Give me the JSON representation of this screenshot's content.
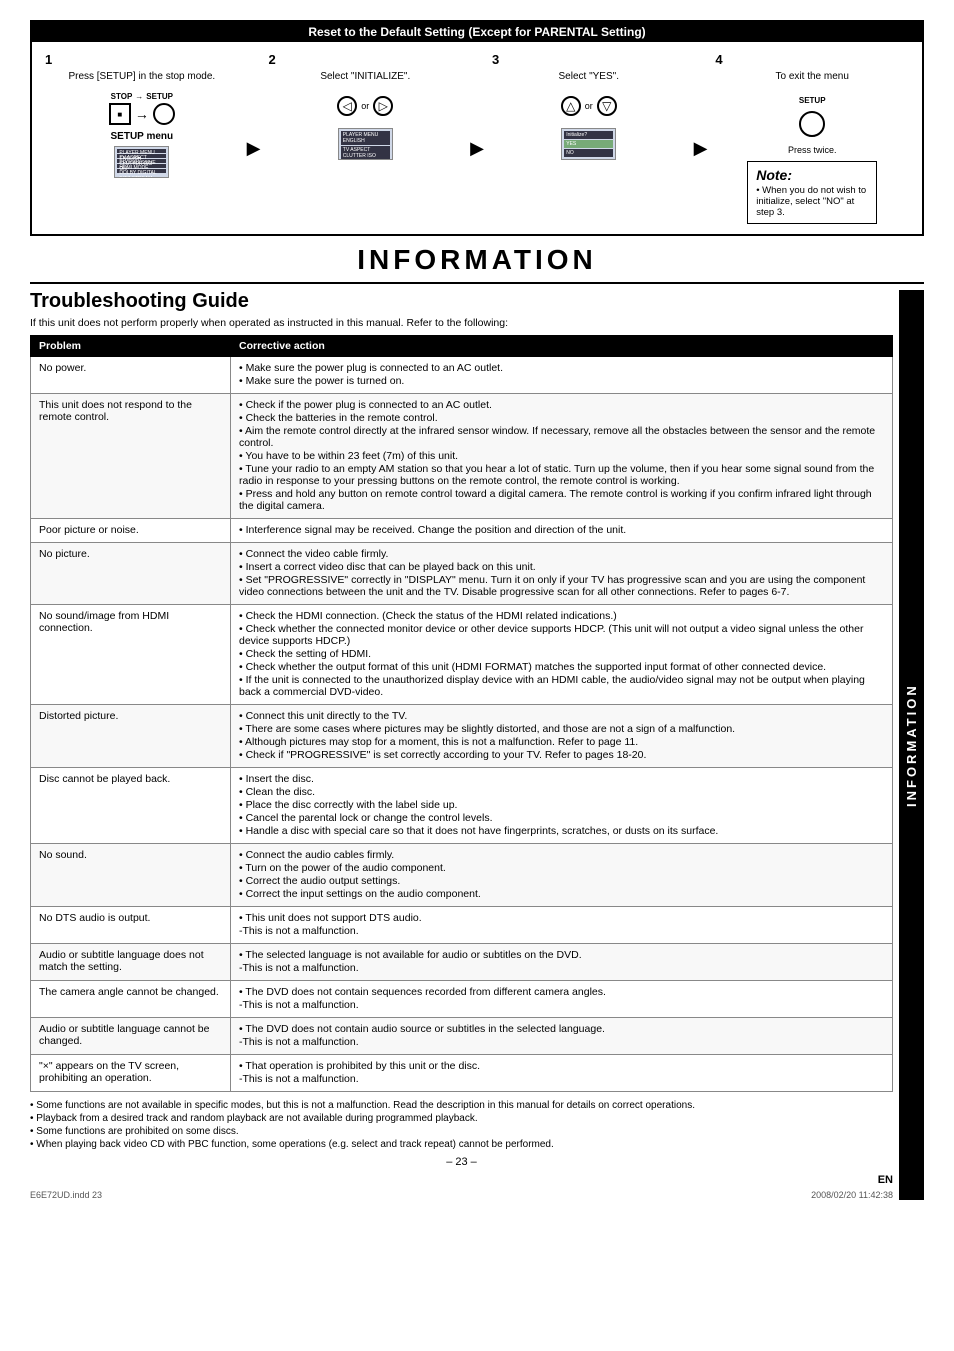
{
  "reset_section": {
    "title": "Reset to the Default Setting (Except for PARENTAL Setting)",
    "steps": [
      {
        "number": "1",
        "desc": "Press [SETUP] in the stop mode.",
        "labels": [
          "STOP",
          "SETUP"
        ],
        "sub": "SETUP menu"
      },
      {
        "number": "2",
        "desc": "Select \"INITIALIZE\"."
      },
      {
        "number": "3",
        "desc": "Select \"YES\"."
      },
      {
        "number": "4",
        "desc": "To exit the menu",
        "press": "Press twice."
      }
    ],
    "note_label": "Note:",
    "note_text": "• When you do not wish to initialize, select \"NO\" at step 3."
  },
  "information_heading": "INFORMATION",
  "troubleshooting_title": "Troubleshooting Guide",
  "intro_text": "If this unit does not perform properly when operated as instructed in this manual. Refer to the following:",
  "table_headers": [
    "Problem",
    "Corrective action"
  ],
  "table_rows": [
    {
      "problem": "No power.",
      "action": "• Make sure the power plug is connected to an AC outlet.\n• Make sure the power is turned on."
    },
    {
      "problem": "This unit does not respond to the remote control.",
      "action": "• Check if the power plug is connected to an AC outlet.\n• Check the batteries in the remote control.\n• Aim the remote control directly at the infrared sensor window. If necessary, remove all the obstacles between the sensor and the remote control.\n• You have to be within 23 feet (7m) of this unit.\n• Tune your radio to an empty AM station so that you hear a lot of static. Turn up the volume, then if you hear some signal sound from the radio in response to your pressing buttons on the remote control, the remote control is working.\n• Press and hold any button on remote control toward a digital camera. The remote control is working if you confirm infrared light through the digital camera."
    },
    {
      "problem": "Poor picture or noise.",
      "action": "• Interference signal may be received. Change the position and direction of the unit."
    },
    {
      "problem": "No picture.",
      "action": "• Connect the video cable firmly.\n• Insert a correct video disc that can be played back on this unit.\n• Set \"PROGRESSIVE\" correctly in \"DISPLAY\" menu. Turn it on only if your TV has progressive scan and you are using the component video connections between the unit and the TV. Disable progressive scan for all other connections. Refer to pages 6-7."
    },
    {
      "problem": "No sound/image from HDMI connection.",
      "action": "• Check the HDMI connection. (Check the status of the HDMI related indications.)\n• Check whether the connected monitor device or other device supports HDCP. (This unit will not output a video signal unless the other device supports HDCP.)\n• Check the setting of HDMI.\n• Check whether the output format of this unit (HDMI FORMAT) matches the supported input format of other connected device.\n• If the unit is connected to the unauthorized display device with an HDMI cable, the audio/video signal may not be output when playing back a commercial DVD-video."
    },
    {
      "problem": "Distorted picture.",
      "action": "• Connect this unit directly to the TV.\n• There are some cases where pictures may be slightly distorted, and those are not a sign of a malfunction.\n• Although pictures may stop for a moment, this is not a malfunction. Refer to page 11.\n• Check if \"PROGRESSIVE\" is set correctly according to your TV. Refer to pages 18-20."
    },
    {
      "problem": "Disc cannot be played back.",
      "action": "• Insert the disc.\n• Clean the disc.\n• Place the disc correctly with the label side up.\n• Cancel the parental lock or change the control levels.\n• Handle a disc with special care so that it does not have fingerprints, scratches, or dusts on its surface."
    },
    {
      "problem": "No sound.",
      "action": "• Connect the audio cables firmly.\n• Turn on the power of the audio component.\n• Correct the audio output settings.\n• Correct the input settings on the audio component."
    },
    {
      "problem": "No DTS audio is output.",
      "action": "• This unit does not support DTS audio.\n-This is not a malfunction."
    },
    {
      "problem": "Audio or subtitle language does not match the setting.",
      "action": "• The selected language is not available for audio or subtitles on the DVD.\n-This is not a malfunction."
    },
    {
      "problem": "The camera angle cannot be changed.",
      "action": "• The DVD does not contain sequences recorded from different camera angles.\n-This is not a malfunction."
    },
    {
      "problem": "Audio or subtitle language cannot be changed.",
      "action": "• The DVD does not contain audio source or subtitles in the selected language.\n-This is not a malfunction."
    },
    {
      "problem": "\"×\" appears on the TV screen, prohibiting an operation.",
      "action": "• That operation is prohibited by this unit or the disc.\n-This is not a malfunction."
    }
  ],
  "footer_notes": [
    "• Some functions are not available in specific modes, but this is not a malfunction. Read the description in this manual for details on correct operations.",
    "• Playback from a desired track and random playback are not available during programmed playback.",
    "• Some functions are prohibited on some discs.",
    "• When playing back video CD with PBC function, some operations (e.g. select and track repeat) cannot be performed."
  ],
  "page_number": "– 23 –",
  "en_label": "EN",
  "file_info_left": "E6E72UD.indd  23",
  "file_info_right": "2008/02/20  11:42:38",
  "info_sidebar_text": "INFORMATION"
}
